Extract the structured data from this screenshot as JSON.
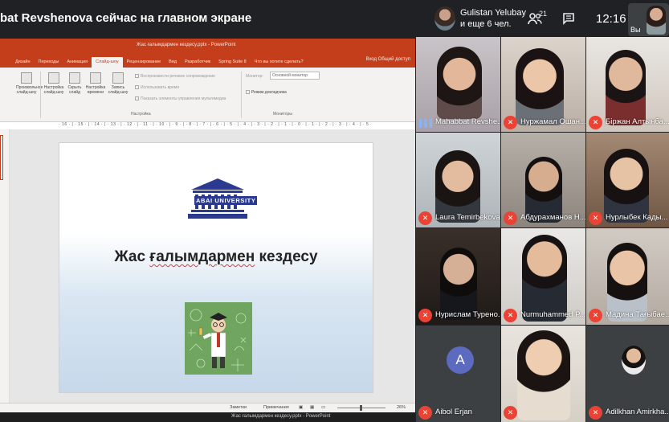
{
  "header": {
    "presenter_banner": "bat Revshenova сейчас на главном экране",
    "host_name": "Gulistan Yelubay",
    "host_others": "и еще 6 чел.",
    "participants_count": "21",
    "clock": "12:16",
    "self_label": "Вы"
  },
  "powerpoint": {
    "doc_title": "Жас ғалымдармен кездесу.pptx - PowerPoint",
    "tabs": [
      "Дизайн",
      "Переходы",
      "Анимация",
      "Слайд-шоу",
      "Рецензирование",
      "Вид",
      "Разработчик",
      "Spring Suite 8",
      "Что вы хотите сделать?"
    ],
    "active_tab": "Слайд-шоу",
    "right_buttons": "Вход   Общий доступ",
    "ribbon_buttons": [
      "Произвольное слайд-шоу",
      "Настройка слайд-шоу",
      "Скрыть слайд",
      "Настройка времени",
      "Запись слайд-шоу"
    ],
    "ribbon_checks": [
      "Воспроизвести речевое сопровождение",
      "Использовать время",
      "Показать элементы управления мультимедиа"
    ],
    "monitor_label": "Монитор:",
    "monitor_value": "Основной монитор",
    "presenter_view_label": "Режим докладчика",
    "group_settings": "Настройка",
    "group_monitors": "Мониторы",
    "ruler_text": "· 16 · | · 15 · | · 14 · | · 13 · | · 12 · | · 11 · | · 10 · | · 9 · | · 8 · | · 7 · | · 6 · | · 5 · | · 4 · | · 3 · | · 2 · | · 1 · | · 0 · | · 1 · | · 2 · | · 3 · | · 4 · | · 5 · | · 6 · | · 7 · | · 8 · | · 9 · | · 10 · | · 11 · | · 12 · | · 13 · | · 14 · | · 15 · | · 16 ·",
    "slide_title": "Жас ғалымдармен кездесу",
    "slide_title_underlined": "ғалымдармен",
    "slide_title_prefix": "Жас ",
    "slide_title_suffix": " кездесу",
    "logo_text": "ABAI UNIVERSITY",
    "status_notes": "Заметки",
    "status_comments": "Примечания",
    "zoom": "26%",
    "taskbar_text": "Жас ғалымдармен кездесу.pptx - PowerPoint"
  },
  "participants": [
    {
      "name": "Mahabbat Revshe...",
      "mic": "on",
      "speaking": true
    },
    {
      "name": "Нуржамал Ошан...",
      "mic": "off",
      "speaking": false
    },
    {
      "name": "Біржан Алтынба...",
      "mic": "off",
      "speaking": false
    },
    {
      "name": "Laura Temirbekova",
      "mic": "off",
      "speaking": false
    },
    {
      "name": "Абдурахманов Н...",
      "mic": "off",
      "speaking": false
    },
    {
      "name": "Нурлыбек Кады...",
      "mic": "off",
      "speaking": false
    },
    {
      "name": "Нурислам Турено...",
      "mic": "off",
      "speaking": false
    },
    {
      "name": "Nurmuhammed P...",
      "mic": "off",
      "speaking": false
    },
    {
      "name": "Мадина Тағыбае...",
      "mic": "off",
      "speaking": false
    },
    {
      "name": "Aibol Erjan",
      "mic": "off",
      "speaking": false,
      "avatar_letter": "A"
    },
    {
      "name": "",
      "mic": "off",
      "speaking": false
    },
    {
      "name": "Adilkhan Amirkha...",
      "mic": "off",
      "speaking": false
    }
  ],
  "colors": {
    "meet_bg": "#202124",
    "tile_bg": "#3c4043",
    "mic_off": "#ea4335",
    "speaking_border": "#1a73e8",
    "ppt_accent": "#c43e1c"
  },
  "icons": [
    "people-icon",
    "chat-icon",
    "mic-on-icon",
    "mic-off-icon",
    "powerpoint-icon"
  ]
}
